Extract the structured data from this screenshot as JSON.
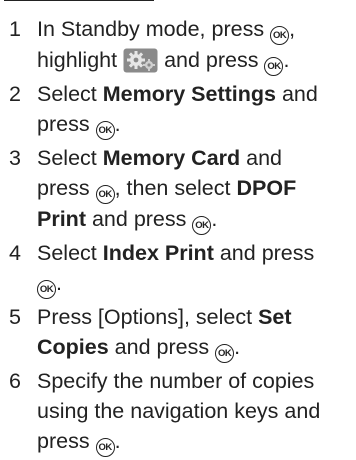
{
  "ok_label": "OK",
  "steps": [
    {
      "num": "1",
      "t1": "In Standby mode, press",
      "t2": ",",
      "t3": "highlight",
      "t4": "and press",
      "t5": "."
    },
    {
      "num": "2",
      "t1": "Select",
      "b1": "Memory Settings",
      "t2": "and",
      "t3": "press",
      "t4": "."
    },
    {
      "num": "3",
      "t1": "Select",
      "b1": "Memory Card",
      "t2": "and",
      "t3": "press",
      "t4": ", then select",
      "b2": "DPOF",
      "b3": "Print",
      "t5": "and press",
      "t6": "."
    },
    {
      "num": "4",
      "t1": "Select",
      "b1": "Index Print",
      "t2": "and press",
      "t3": "."
    },
    {
      "num": "5",
      "t1": "Press [Options], select",
      "b1": "Set",
      "b2": "Copies",
      "t2": "and press",
      "t3": "."
    },
    {
      "num": "6",
      "t1": "Specify the number of copies",
      "t2": "using the navigation keys and",
      "t3": "press",
      "t4": "."
    }
  ]
}
